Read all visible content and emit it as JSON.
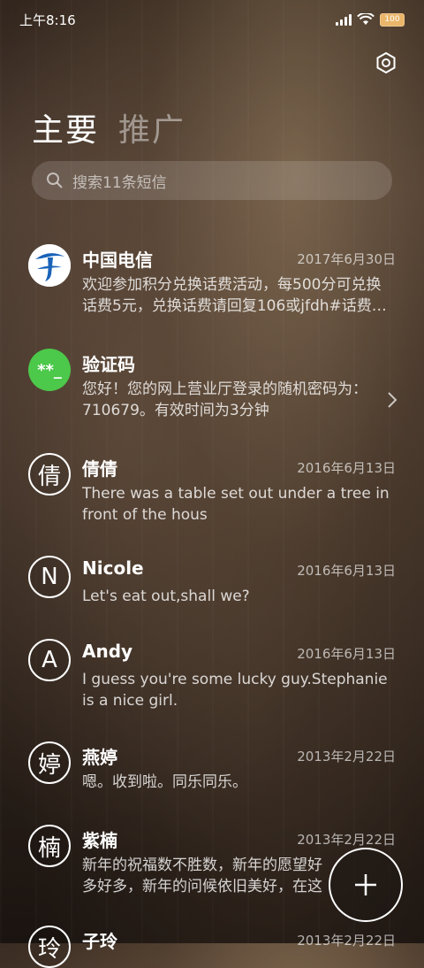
{
  "status_bar": {
    "time": "上午8:16",
    "battery": "100"
  },
  "header": {
    "tabs": [
      {
        "label": "主要"
      },
      {
        "label": "推广"
      }
    ]
  },
  "search": {
    "placeholder": "搜索11条短信"
  },
  "colors": {
    "avatar_green": "#4cc84a",
    "telecom_blue": "#1a63b8"
  },
  "messages": [
    {
      "name": "中国电信",
      "date": "2017年6月30日",
      "preview": "欢迎参加积分兑换话费活动，每500分可兑换话费5元，兑换话费请回复106或jfdh#话费…",
      "avatar": "telecom-logo-icon"
    },
    {
      "name": "验证码",
      "date": "",
      "preview": "您好！您的网上营业厅登录的随机密码为：710679。有效时间为3分钟",
      "avatar": "**_"
    },
    {
      "name": "倩倩",
      "date": "2016年6月13日",
      "preview": "There was a table set out under a tree in front of the hous",
      "avatar": "倩"
    },
    {
      "name": "Nicole",
      "date": "2016年6月13日",
      "preview": "Let's eat out,shall we?",
      "avatar": "N"
    },
    {
      "name": "Andy",
      "date": "2016年6月13日",
      "preview": "I guess you're some lucky guy.Stephanie is a nice girl.",
      "avatar": "A"
    },
    {
      "name": "燕婷",
      "date": "2013年2月22日",
      "preview": "嗯。收到啦。同乐同乐。",
      "avatar": "婷"
    },
    {
      "name": "紫楠",
      "date": "2013年2月22日",
      "preview": "新年的祝福数不胜数，新年的愿望好多好多，新年的问候依旧美好，在这个温馨的",
      "avatar": "楠"
    },
    {
      "name": "子玲",
      "date": "2013年2月22日",
      "preview": "",
      "avatar": "玲"
    }
  ]
}
